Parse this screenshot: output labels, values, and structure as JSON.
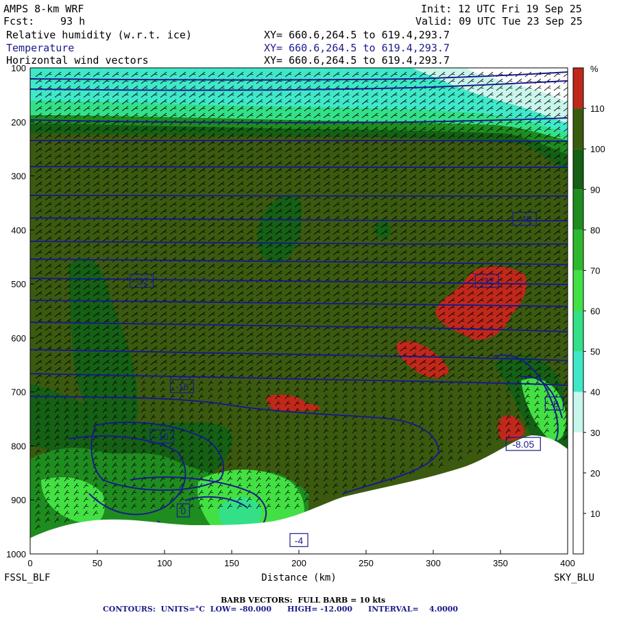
{
  "header": {
    "model": "AMPS 8-km WRF",
    "fcst_label": "Fcst:",
    "fcst_value": "93 h",
    "init": "Init: 12 UTC Fri 19 Sep 25",
    "valid": "Valid: 09 UTC Tue 23 Sep 25",
    "fields": [
      {
        "name": "Relative humidity (w.r.t. ice)",
        "xy": "XY= 660.6,264.5 to 619.4,293.7"
      },
      {
        "name": "Temperature",
        "xy": "XY= 660.6,264.5 to 619.4,293.7"
      },
      {
        "name": "Horizontal wind vectors",
        "xy": "XY= 660.6,264.5 to 619.4,293.7"
      }
    ]
  },
  "footer": {
    "barb": "BARB VECTORS:  FULL BARB = 10 kts",
    "contours": "CONTOURS:  UNITS=°C  LOW= -80.000      HIGH= -12.000      INTERVAL=    4.0000"
  },
  "chart_data": {
    "type": "heatmap",
    "title": "Relative humidity (w.r.t. ice) / Temperature / Horizontal wind vectors",
    "xlabel": "Distance (km)",
    "ylabel": "",
    "xlim": [
      0,
      400
    ],
    "ylim": [
      1000,
      100
    ],
    "x_ticks": [
      0,
      50,
      100,
      150,
      200,
      250,
      300,
      350,
      400
    ],
    "y_ticks": [
      100,
      200,
      300,
      400,
      500,
      600,
      700,
      800,
      900,
      1000
    ],
    "x_endpoints": {
      "left": "FSSL_BLF",
      "right": "SKY_BLU"
    },
    "colorbar": {
      "unit": "%",
      "levels": [
        10,
        20,
        30,
        40,
        50,
        60,
        70,
        80,
        90,
        100,
        110
      ],
      "colors": [
        "#ffffff",
        "#ffffff",
        "#ffffff",
        "#c8f5ec",
        "#3fe8c8",
        "#33e088",
        "#43e043",
        "#2fb82f",
        "#1f8c1f",
        "#156015",
        "#3b5a0f",
        "#c0281a"
      ]
    },
    "temperature_contour_labels": [
      {
        "label": "-48",
        "x": 368,
        "p": 380
      },
      {
        "label": "-32",
        "x": 83,
        "p": 495
      },
      {
        "label": "-32",
        "x": 340,
        "p": 495
      },
      {
        "label": "-16",
        "x": 113,
        "p": 690
      },
      {
        "label": "-16",
        "x": 98,
        "p": 783
      },
      {
        "label": "-8",
        "x": 390,
        "p": 722
      },
      {
        "label": "-8.05",
        "x": 367,
        "p": 797
      },
      {
        "label": "0",
        "x": 114,
        "p": 920
      },
      {
        "label": "-4",
        "x": 200,
        "p": 975
      }
    ],
    "barb_note": "FULL BARB = 10 kts",
    "contour_units": "°C",
    "contour_low": -80.0,
    "contour_high": -12.0,
    "contour_interval": 4.0
  }
}
